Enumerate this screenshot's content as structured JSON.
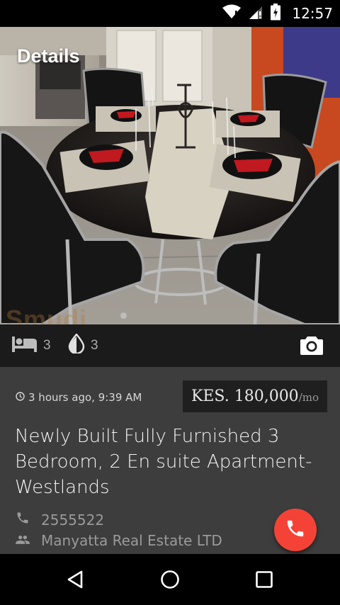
{
  "status_bar": {
    "time": "12:57",
    "icons": [
      "wifi-icon",
      "cellular-signal-icon",
      "battery-icon"
    ]
  },
  "header": {
    "title": "Details"
  },
  "hero": {
    "watermark": "Smudi",
    "page_indicator": {
      "current": 1,
      "total": 1
    }
  },
  "features": {
    "bedrooms": {
      "icon": "bed-icon",
      "count": "3"
    },
    "bathrooms": {
      "icon": "water-drop-icon",
      "count": "3"
    },
    "gallery_icon": "camera-icon"
  },
  "listing": {
    "posted_icon": "clock-icon",
    "posted": "3 hours ago, 9:39 AM",
    "price": "KES. 180,000",
    "price_unit": "/mo",
    "title": "Newly Built Fully Furnished 3 Bedroom, 2 En suite Apartment-Westlands",
    "phone_icon": "phone-icon",
    "phone": "2555522",
    "agent_icon": "people-icon",
    "agent": "Manyatta Real Estate LTD"
  },
  "fab": {
    "icon": "phone-icon"
  },
  "nav_bar": {
    "icons": [
      "back-icon",
      "home-icon",
      "recents-icon"
    ]
  },
  "colors": {
    "accent": "#f44336",
    "background": "#3d3d3d",
    "price_box": "#1f1f1f",
    "icon_bar": "#1b1b1b"
  }
}
